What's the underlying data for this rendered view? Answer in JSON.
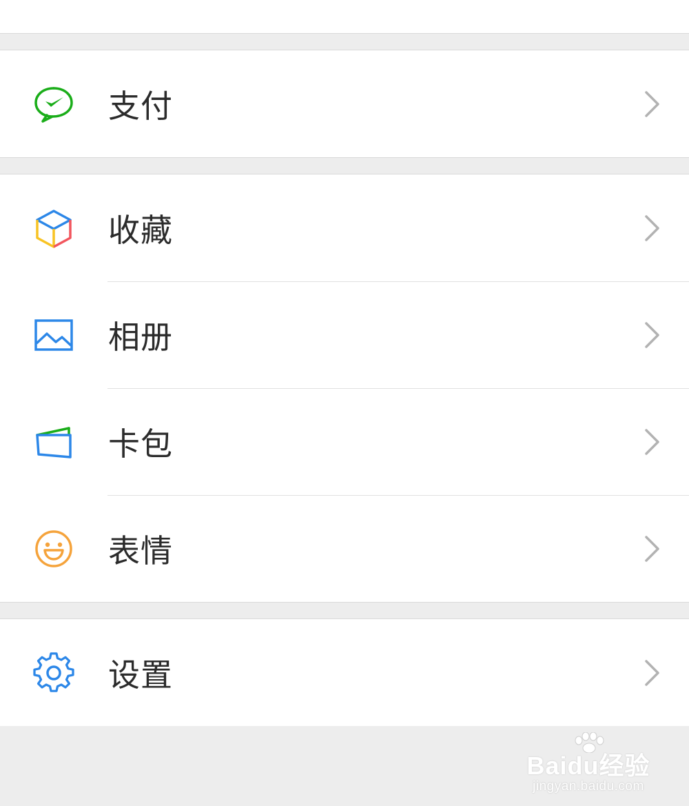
{
  "sections": [
    {
      "items": [
        {
          "label": "支付",
          "icon": "wechat-pay-icon"
        }
      ]
    },
    {
      "items": [
        {
          "label": "收藏",
          "icon": "favorites-cube-icon"
        },
        {
          "label": "相册",
          "icon": "album-picture-icon"
        },
        {
          "label": "卡包",
          "icon": "card-wallet-icon"
        },
        {
          "label": "表情",
          "icon": "smiley-face-icon"
        }
      ]
    },
    {
      "items": [
        {
          "label": "设置",
          "icon": "gear-icon"
        }
      ]
    }
  ],
  "colors": {
    "pay_green": "#1aad19",
    "blue": "#2c87e8",
    "orange": "#f5a33b",
    "red": "#f2555d",
    "yellow": "#f8c323",
    "chevron": "#b2b2b2",
    "text": "#2b2b2b",
    "background": "#ededed"
  },
  "watermark": {
    "main": "Baidu经验",
    "sub": "jingyan.baidu.com"
  }
}
